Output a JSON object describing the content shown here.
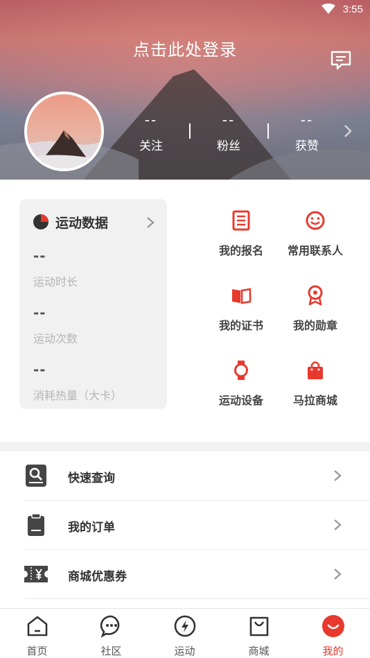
{
  "status_bar": {
    "time": "3:55"
  },
  "header": {
    "login_prompt": "点击此处登录",
    "stats": [
      {
        "value": "--",
        "label": "关注"
      },
      {
        "value": "--",
        "label": "粉丝"
      },
      {
        "value": "--",
        "label": "获赞"
      }
    ]
  },
  "sports_data": {
    "title": "运动数据",
    "metrics": [
      {
        "value": "--",
        "label": "运动时长"
      },
      {
        "value": "--",
        "label": "运动次数"
      },
      {
        "value": "--",
        "label": "消耗热量（大卡）"
      }
    ]
  },
  "grid": [
    {
      "label": "我的报名",
      "icon": "registration-icon"
    },
    {
      "label": "常用联系人",
      "icon": "contacts-smiley-icon"
    },
    {
      "label": "我的证书",
      "icon": "certificate-book-icon"
    },
    {
      "label": "我的勋章",
      "icon": "medal-icon"
    },
    {
      "label": "运动设备",
      "icon": "smartwatch-icon"
    },
    {
      "label": "马拉商城",
      "icon": "shopping-bag-icon"
    }
  ],
  "list": [
    {
      "label": "快速查询",
      "icon": "search-document-icon"
    },
    {
      "label": "我的订单",
      "icon": "clipboard-icon"
    },
    {
      "label": "商城优惠券",
      "icon": "coupon-yuan-icon"
    }
  ],
  "tabbar": [
    {
      "label": "首页",
      "icon": "home-icon",
      "active": false
    },
    {
      "label": "社区",
      "icon": "chat-bubble-icon",
      "active": false
    },
    {
      "label": "运动",
      "icon": "lightning-icon",
      "active": false
    },
    {
      "label": "商城",
      "icon": "shopping-bag-icon",
      "active": false
    },
    {
      "label": "我的",
      "icon": "profile-smile-icon",
      "active": true
    }
  ],
  "colors": {
    "accent": "#e8392e",
    "header_top": "#b85d62",
    "header_bottom": "#6d6e79"
  }
}
